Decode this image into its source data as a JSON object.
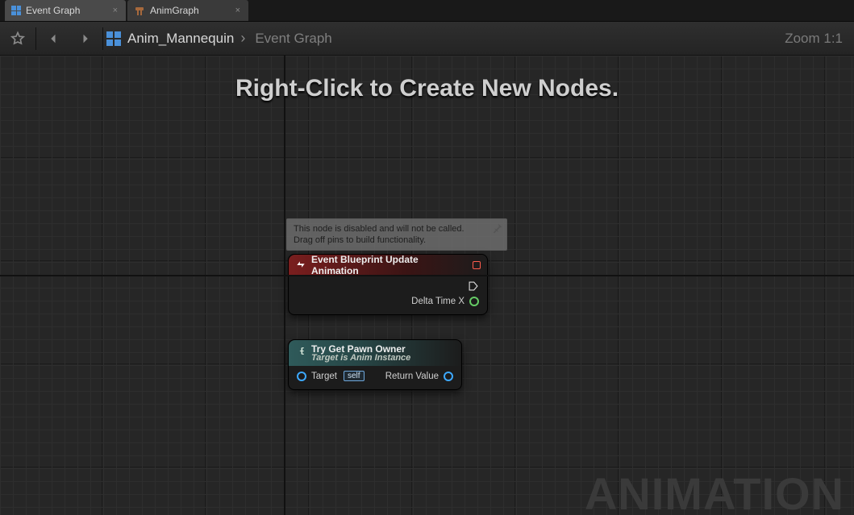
{
  "tabs": [
    {
      "label": "Event Graph",
      "active": true
    },
    {
      "label": "AnimGraph",
      "active": false
    }
  ],
  "breadcrumb": {
    "root": "Anim_Mannequin",
    "current": "Event Graph"
  },
  "zoom": "Zoom 1:1",
  "hint": "Right-Click to Create New Nodes.",
  "watermark": "ANIMATION",
  "disabled_comment": {
    "line1": "This node is disabled and will not be called.",
    "line2": "Drag off pins to build functionality."
  },
  "node_event": {
    "title": "Event Blueprint Update Animation",
    "output_data": "Delta Time X"
  },
  "node_func": {
    "title": "Try Get Pawn Owner",
    "subtitle": "Target is Anim Instance",
    "input_label": "Target",
    "input_chip": "self",
    "output_label": "Return Value"
  }
}
